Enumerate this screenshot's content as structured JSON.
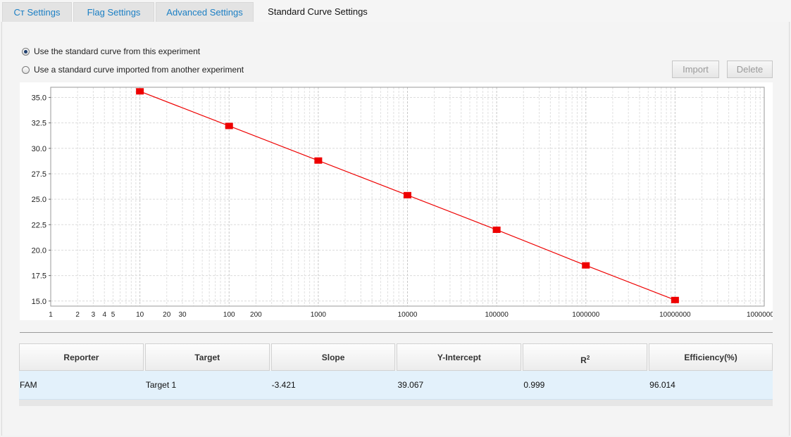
{
  "tabs": {
    "ct_prefix": "Cт",
    "ct_suffix": " Settings",
    "flag": "Flag Settings",
    "advanced": "Advanced Settings",
    "standard_curve": "Standard Curve Settings"
  },
  "options": {
    "use_this": "Use the standard curve from this experiment",
    "use_imported": "Use a standard curve imported from another experiment",
    "selected": "use_this"
  },
  "buttons": {
    "import": "Import",
    "delete": "Delete"
  },
  "chart_data": {
    "type": "scatter",
    "x_scale": "log",
    "xlim": [
      1,
      100000000
    ],
    "ylim": [
      14.5,
      36
    ],
    "x_ticks": [
      1,
      2,
      3,
      4,
      5,
      10,
      20,
      30,
      100,
      200,
      1000,
      10000,
      100000,
      1000000,
      10000000,
      100000000
    ],
    "x_tick_labels": [
      "1",
      "2",
      "3",
      "4",
      "5",
      "10",
      "20",
      "30",
      "100",
      "200",
      "1000",
      "10000",
      "100000",
      "1000000",
      "10000000",
      "100000000"
    ],
    "y_ticks": [
      15.0,
      17.5,
      20.0,
      22.5,
      25.0,
      27.5,
      30.0,
      32.5,
      35.0
    ],
    "y_tick_labels": [
      "15.0",
      "17.5",
      "20.0",
      "22.5",
      "25.0",
      "27.5",
      "30.0",
      "32.5",
      "35.0"
    ],
    "grid": true,
    "series": [
      {
        "color": "#ee0000",
        "points": [
          {
            "x": 10,
            "y": 35.6
          },
          {
            "x": 100,
            "y": 32.2
          },
          {
            "x": 1000,
            "y": 28.8
          },
          {
            "x": 10000,
            "y": 25.4
          },
          {
            "x": 100000,
            "y": 22.0
          },
          {
            "x": 1000000,
            "y": 18.5
          },
          {
            "x": 10000000,
            "y": 15.1
          }
        ]
      }
    ]
  },
  "table": {
    "headers": {
      "reporter": "Reporter",
      "target": "Target",
      "slope": "Slope",
      "y_intercept": "Y-Intercept",
      "r2_base": "R",
      "r2_sup": "2",
      "efficiency": "Efficiency(%)"
    },
    "row": {
      "reporter": "FAM",
      "target": "Target 1",
      "slope": "-3.421",
      "y_intercept": "39.067",
      "r2": "0.999",
      "efficiency": "96.014"
    }
  }
}
